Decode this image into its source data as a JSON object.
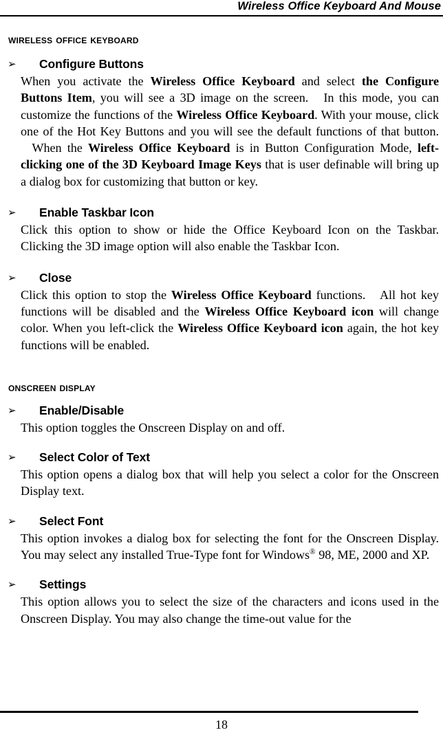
{
  "header": {
    "title": "Wireless Office Keyboard And Mouse"
  },
  "sections": [
    {
      "title": "Wireless Office Keyboard",
      "items": [
        {
          "bullet": "➢",
          "title": "Configure Buttons",
          "body_plain": "When you activate the Wireless Office Keyboard and select the Configure Buttons Item, you will see a 3D image on the screen.   In this mode, you can customize the functions of the Wireless Office Keyboard. With your mouse, click one of the Hot Key Buttons and you will see the default functions of that button.   When the Wireless Office Keyboard is in Button Configuration Mode, left-clicking one of the 3D Keyboard Image Keys that is user definable will bring up a dialog box for customizing that button or key."
        },
        {
          "bullet": "➢",
          "title": "Enable Taskbar Icon",
          "body_plain": "Click this option to show or hide the Office Keyboard Icon on the Taskbar. Clicking the 3D image option will also enable the Taskbar Icon."
        },
        {
          "bullet": "➢",
          "title": "Close",
          "body_plain": "Click this option to stop the Wireless Office Keyboard functions.   All hot key functions will be disabled and the Wireless Office Keyboard icon will change color. When you left-click the Wireless Office Keyboard icon again, the hot key functions will be enabled."
        }
      ]
    },
    {
      "title": "Onscreen Display",
      "items": [
        {
          "bullet": "➢",
          "title": "Enable/Disable",
          "body_plain": "This option toggles the Onscreen Display on and off."
        },
        {
          "bullet": "➢",
          "title": "Select Color of Text",
          "body_plain": "This option opens a dialog box that will help you select a color for the Onscreen Display text."
        },
        {
          "bullet": "➢",
          "title": "Select Font",
          "body_plain": "This option invokes a dialog box for selecting the font for the Onscreen Display. You may select any installed True-Type font for Windows® 98, ME, 2000 and XP."
        },
        {
          "bullet": "➢",
          "title": "Settings",
          "body_plain": "This option allows you to select the size of the characters and icons used in the Onscreen Display. You may also change the time-out value for the"
        }
      ]
    }
  ],
  "footer": {
    "page_number": "18"
  }
}
